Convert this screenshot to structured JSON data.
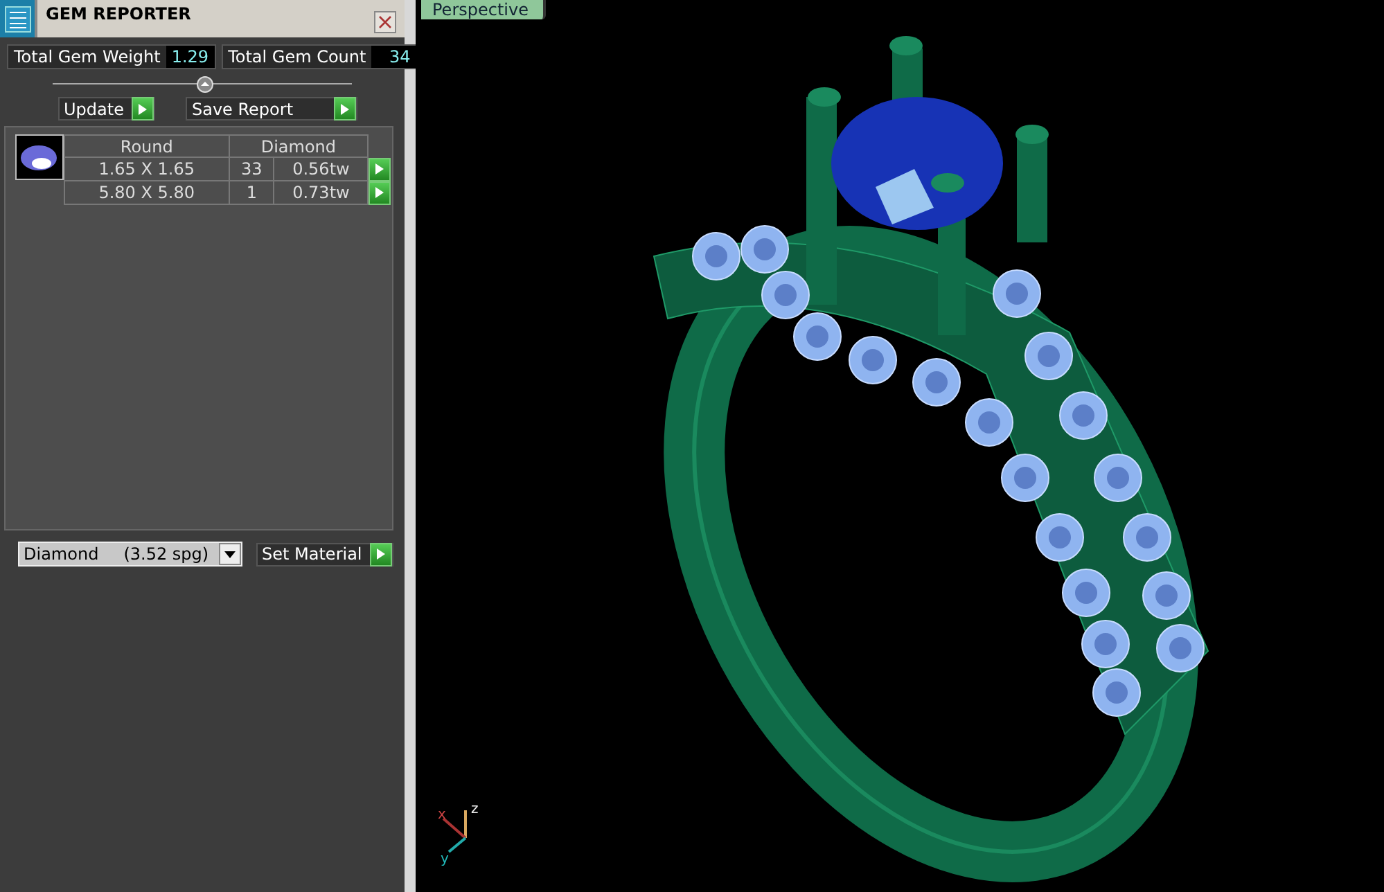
{
  "panel": {
    "title": "GEM REPORTER",
    "totals": [
      {
        "label": "Total Gem Weight",
        "value": "1.29"
      },
      {
        "label": "Total Gem Count",
        "value": "34"
      }
    ],
    "buttons": [
      "Update",
      "Save Report"
    ],
    "table": {
      "columns": [
        "Round",
        "Diamond"
      ],
      "rows": [
        {
          "size": "1.65 X 1.65",
          "count": "33",
          "weight": "0.56tw"
        },
        {
          "size": "5.80 X 5.80",
          "count": "1",
          "weight": "0.73tw"
        }
      ]
    },
    "material": {
      "name": "Diamond",
      "density": "(3.52 spg)"
    },
    "set_button": "Set Material"
  },
  "viewport": {
    "tab": "Perspective",
    "axes": [
      "x",
      "y",
      "z"
    ]
  }
}
